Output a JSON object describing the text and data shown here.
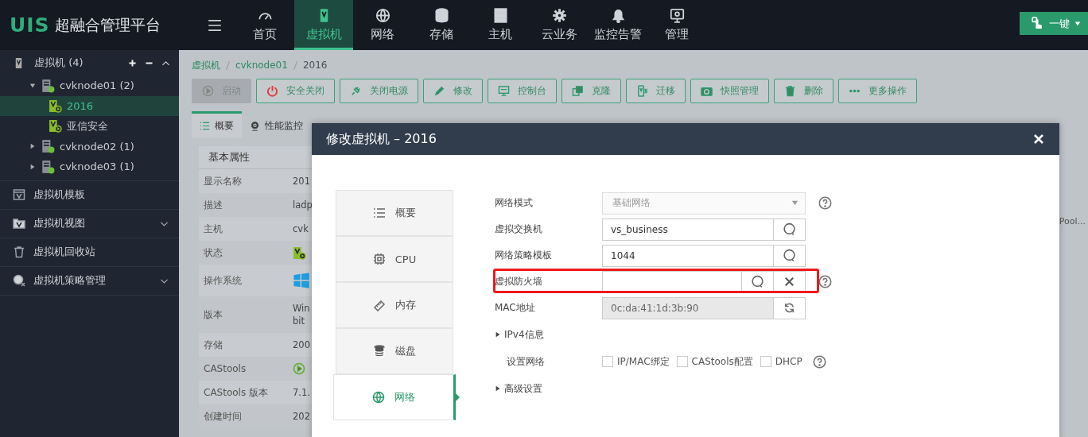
{
  "header": {
    "logo_mark": "UIS",
    "logo_text": "超融合管理平台",
    "nav": [
      {
        "label": "首页",
        "selected": false
      },
      {
        "label": "虚拟机",
        "selected": true
      },
      {
        "label": "网络",
        "selected": false
      },
      {
        "label": "存储",
        "selected": false
      },
      {
        "label": "主机",
        "selected": false
      },
      {
        "label": "云业务",
        "selected": false
      },
      {
        "label": "监控告警",
        "selected": false
      },
      {
        "label": "管理",
        "selected": false
      }
    ],
    "action_button": "一键"
  },
  "sidebar": {
    "tree": {
      "label": "虚拟机 (4)",
      "expanded": true,
      "children": [
        {
          "label": "cvknode01 (2)",
          "expanded": true,
          "selected": false,
          "children": [
            {
              "label": "2016",
              "selected": true
            },
            {
              "label": "亚信安全",
              "selected": false
            }
          ]
        },
        {
          "label": "cvknode02 (1)",
          "expanded": false,
          "selected": false
        },
        {
          "label": "cvknode03 (1)",
          "expanded": false,
          "selected": false
        }
      ]
    },
    "menu": [
      {
        "label": "虚拟机模板",
        "expandable": false
      },
      {
        "label": "虚拟机视图",
        "expandable": true
      },
      {
        "label": "虚拟机回收站",
        "expandable": false
      },
      {
        "label": "虚拟机策略管理",
        "expandable": true
      }
    ]
  },
  "breadcrumb": [
    "虚拟机",
    "cvknode01",
    "2016"
  ],
  "toolbar": [
    {
      "label": "启动",
      "disabled": true
    },
    {
      "label": "安全关闭",
      "disabled": false
    },
    {
      "label": "关闭电源",
      "disabled": false
    },
    {
      "label": "修改",
      "disabled": false
    },
    {
      "label": "控制台",
      "disabled": false
    },
    {
      "label": "克隆",
      "disabled": false
    },
    {
      "label": "迁移",
      "disabled": false
    },
    {
      "label": "快照管理",
      "disabled": false
    },
    {
      "label": "删除",
      "disabled": false
    },
    {
      "label": "更多操作",
      "disabled": false
    }
  ],
  "tabs": [
    {
      "label": "概要",
      "selected": true
    },
    {
      "label": "性能监控",
      "selected": false
    }
  ],
  "properties": {
    "title": "基本属性",
    "rows": [
      {
        "label": "显示名称",
        "kind": "text",
        "value": "201"
      },
      {
        "label": "描述",
        "kind": "text",
        "value": "ladp"
      },
      {
        "label": "主机",
        "kind": "text",
        "value": "cvk"
      },
      {
        "label": "状态",
        "kind": "status"
      },
      {
        "label": "操作系统",
        "kind": "os"
      },
      {
        "label": "版本",
        "kind": "text",
        "value": "Win",
        "value_2": "bit"
      },
      {
        "label": "存储",
        "kind": "text",
        "value": "200"
      },
      {
        "label": "CAStools",
        "kind": "tools"
      },
      {
        "label": "CAStools 版本",
        "kind": "text",
        "value": "7.1."
      },
      {
        "label": "创建时间",
        "kind": "text",
        "value": "202"
      }
    ]
  },
  "background_fragment": "Pool...",
  "modal": {
    "title": "修改虚拟机 – 2016",
    "nav": [
      {
        "label": "概要",
        "selected": false
      },
      {
        "label": "CPU",
        "selected": false
      },
      {
        "label": "内存",
        "selected": false
      },
      {
        "label": "磁盘",
        "selected": false
      },
      {
        "label": "网络",
        "selected": true
      }
    ],
    "fields": [
      {
        "label": "网络模式",
        "kind": "select",
        "value": "基础网络",
        "disabled": true,
        "help": true,
        "highlighted": false
      },
      {
        "label": "虚拟交换机",
        "kind": "lookup",
        "value": "vs_business",
        "help": false,
        "highlighted": false
      },
      {
        "label": "网络策略模板",
        "kind": "lookup",
        "value": "1044",
        "help": false,
        "highlighted": false
      },
      {
        "label": "虚拟防火墙",
        "kind": "lookup_clear",
        "help": true,
        "highlighted": true
      },
      {
        "label": "MAC地址",
        "kind": "mac",
        "value": "0c:da:41:1d:3b:90",
        "help": false,
        "highlighted": false
      }
    ],
    "ipv4_section": {
      "label": "IPv4信息",
      "expanded": false
    },
    "network_settings": {
      "label": "设置网络",
      "options": [
        {
          "label": "IP/MAC绑定",
          "checked": false
        },
        {
          "label": "CAStools配置",
          "checked": false
        },
        {
          "label": "DHCP",
          "checked": false
        }
      ],
      "help": true
    },
    "advanced_section": {
      "label": "高级设置",
      "expanded": false
    }
  }
}
